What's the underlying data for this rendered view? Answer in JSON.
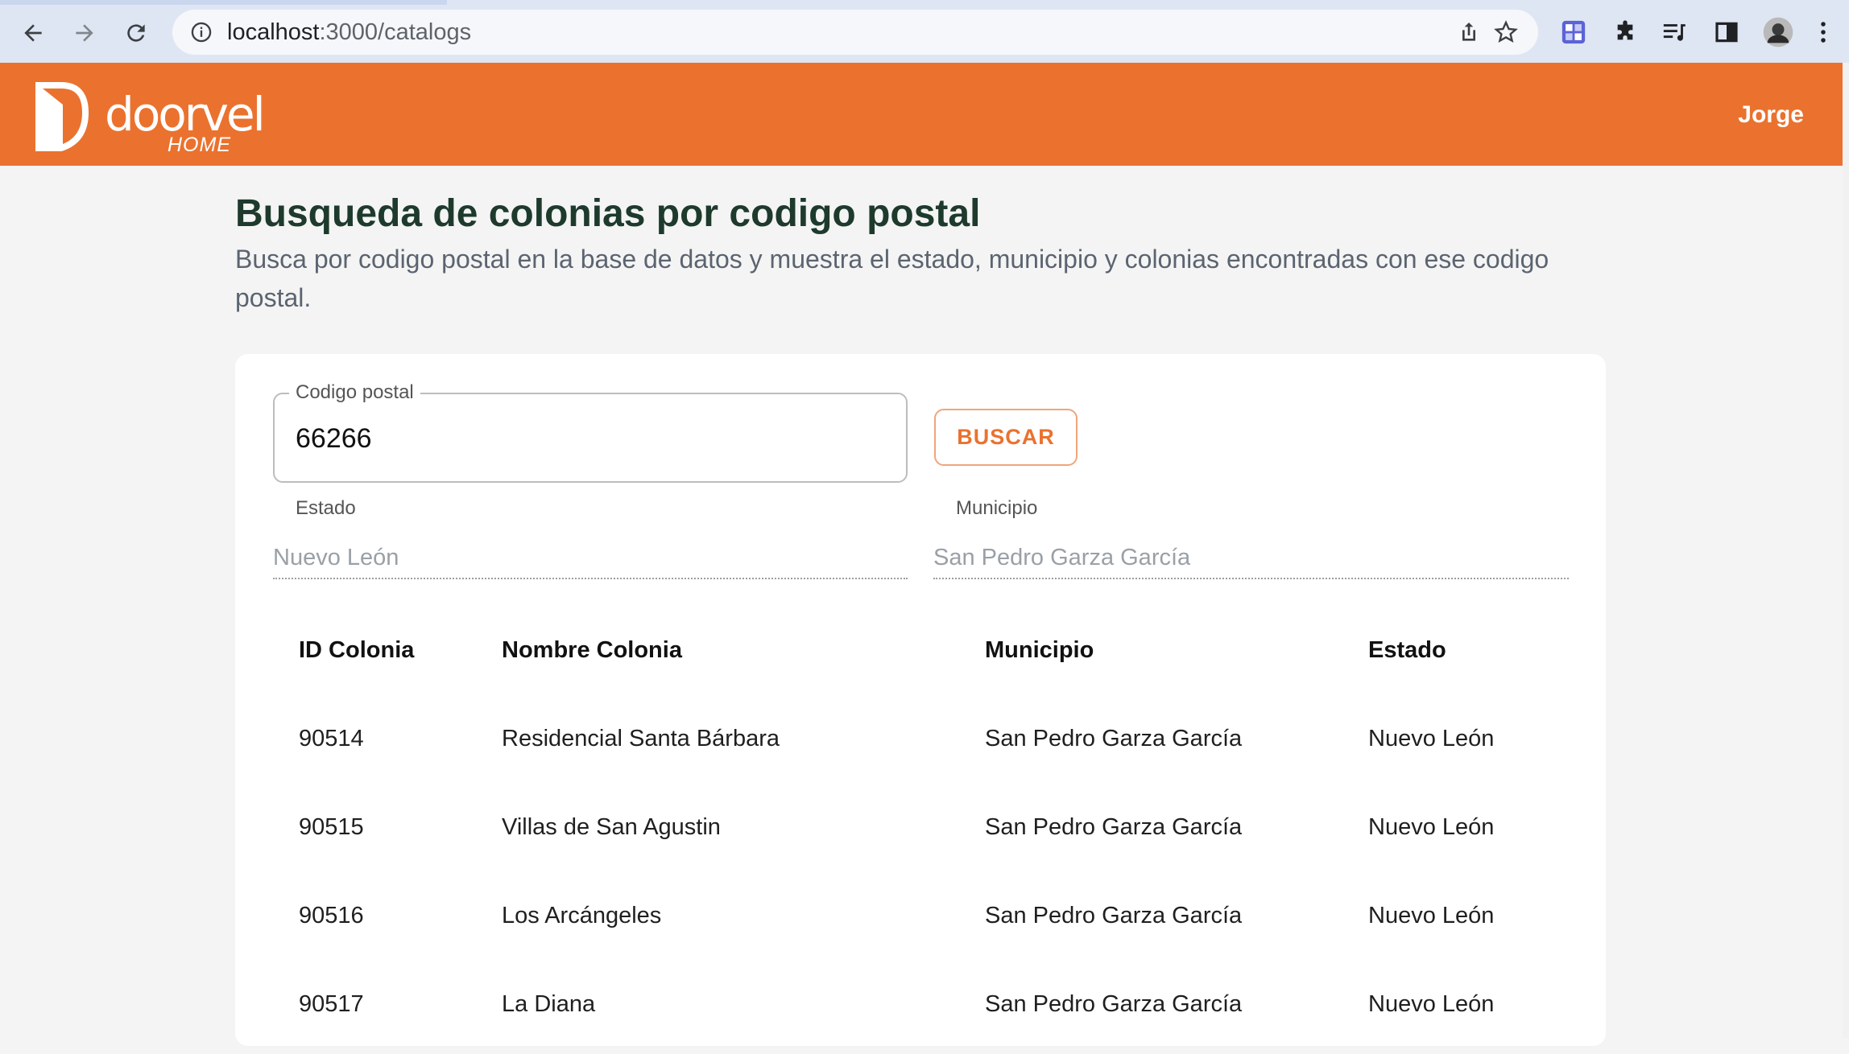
{
  "browser": {
    "url_host": "localhost",
    "url_path": ":3000/catalogs"
  },
  "app": {
    "brand_name": "doorvel",
    "brand_sub": "HOME",
    "user_name": "Jorge"
  },
  "page": {
    "title": "Busqueda de colonias por codigo postal",
    "subtitle": "Busca por codigo postal en la base de datos y muestra el estado, municipio y colonias encontradas con ese codigo postal."
  },
  "search": {
    "label": "Codigo postal",
    "value": "66266",
    "button_label": "BUSCAR"
  },
  "result": {
    "estado_label": "Estado",
    "estado_value": "Nuevo León",
    "municipio_label": "Municipio",
    "municipio_value": "San Pedro Garza García"
  },
  "table": {
    "headers": [
      "ID Colonia",
      "Nombre Colonia",
      "Municipio",
      "Estado"
    ],
    "rows": [
      [
        "90514",
        "Residencial Santa Bárbara",
        "San Pedro Garza García",
        "Nuevo León"
      ],
      [
        "90515",
        "Villas de San Agustin",
        "San Pedro Garza García",
        "Nuevo León"
      ],
      [
        "90516",
        "Los Arcángeles",
        "San Pedro Garza García",
        "Nuevo León"
      ],
      [
        "90517",
        "La Diana",
        "San Pedro Garza García",
        "Nuevo León"
      ]
    ]
  },
  "colors": {
    "brand_orange": "#ea722e",
    "title_green": "#1e3a2c"
  }
}
